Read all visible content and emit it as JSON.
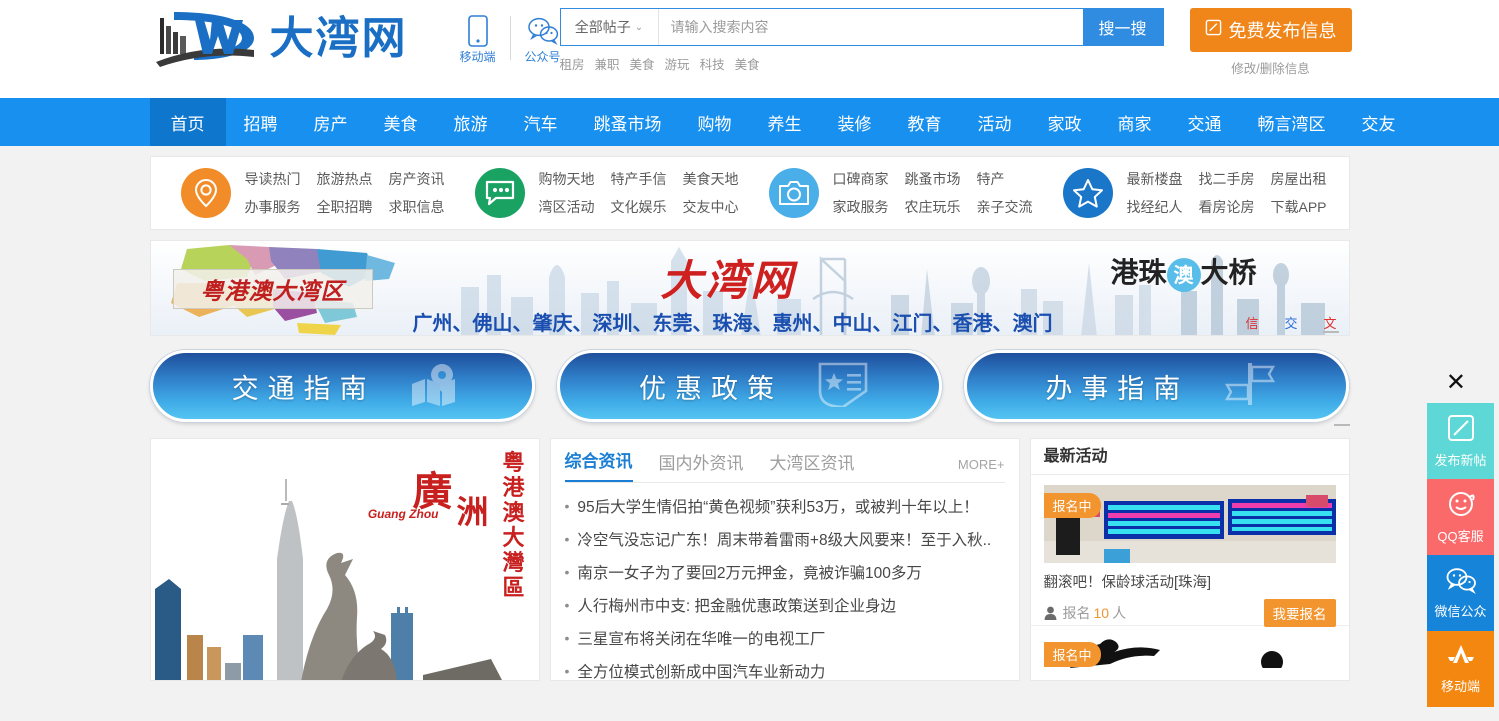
{
  "site": {
    "logo_text": "大湾网",
    "logo_mark": "dw-logo-icon"
  },
  "header": {
    "app_icons": [
      {
        "icon": "mobile-phone-icon",
        "label": "移动端"
      },
      {
        "icon": "wechat-icon",
        "label": "公众号"
      }
    ],
    "search": {
      "category": "全部帖子",
      "chevron": "⌄",
      "placeholder": "请输入搜索内容",
      "value": "",
      "button_label": "搜一搜",
      "hotwords": [
        "租房",
        "兼职",
        "美食",
        "游玩",
        "科技",
        "美食"
      ]
    },
    "publish": {
      "icon": "compose-icon",
      "label": "免费发布信息",
      "sub_label": "修改/删除信息",
      "color": "#f08519"
    }
  },
  "nav": {
    "active_index": 0,
    "bg_color": "#1890ef",
    "active_color": "#0f76cd",
    "items": [
      {
        "label": "首页"
      },
      {
        "label": "招聘"
      },
      {
        "label": "房产"
      },
      {
        "label": "美食"
      },
      {
        "label": "旅游"
      },
      {
        "label": "汽车"
      },
      {
        "label": "跳蚤市场"
      },
      {
        "label": "购物"
      },
      {
        "label": "养生"
      },
      {
        "label": "装修"
      },
      {
        "label": "教育"
      },
      {
        "label": "活动"
      },
      {
        "label": "家政"
      },
      {
        "label": "商家"
      },
      {
        "label": "交通"
      },
      {
        "label": "畅言湾区"
      },
      {
        "label": "交友"
      }
    ]
  },
  "quick_links": {
    "groups": [
      {
        "icon": "location-pin-icon",
        "color": "#f28c28",
        "links": [
          "导读热门",
          "旅游热点",
          "房产资讯",
          "办事服务",
          "全职招聘",
          "求职信息"
        ]
      },
      {
        "icon": "chat-bubble-icon",
        "color": "#1aa263",
        "links": [
          "购物天地",
          "特产手信",
          "美食天地",
          "湾区活动",
          "文化娱乐",
          "交友中心"
        ]
      },
      {
        "icon": "camera-icon",
        "color": "#4aaee8",
        "links": [
          "口碑商家",
          "跳蚤市场",
          "特产",
          "家政服务",
          "农庄玩乐",
          "亲子交流"
        ]
      },
      {
        "icon": "star-icon",
        "color": "#1a76c9",
        "links": [
          "最新楼盘",
          "找二手房",
          "房屋出租",
          "找经纪人",
          "看房论房",
          "下载APP"
        ]
      }
    ]
  },
  "banner": {
    "plaque_text": "粤港澳大湾区",
    "title": "大湾网",
    "cities": "广州、佛山、肇庆、深圳、东莞、珠海、惠州、中山、江门、香港、澳门",
    "bridge_a": "港珠",
    "bridge_ao": "澳",
    "bridge_b": "大桥",
    "tags": [
      {
        "label": "信息",
        "color": "#e03030"
      },
      {
        "label": "交流",
        "color": "#2a6fd8"
      },
      {
        "label": "文化",
        "color": "#e03030"
      }
    ]
  },
  "triple_buttons": [
    {
      "label": "交通指南",
      "icon": "map-pin-icon"
    },
    {
      "label": "优惠政策",
      "icon": "badge-star-icon"
    },
    {
      "label": "办事指南",
      "icon": "signpost-icon"
    }
  ],
  "left_image": {
    "city_big": "廣",
    "city_zhou": "洲",
    "pinyin": "Guang Zhou",
    "vertical": "粤港澳大灣區",
    "alt": "guangzhou-skyline-goat-statue-image"
  },
  "news": {
    "tabs": [
      {
        "label": "综合资讯",
        "active": true
      },
      {
        "label": "国内外资讯",
        "active": false
      },
      {
        "label": "大湾区资讯",
        "active": false
      }
    ],
    "more_label": "MORE+",
    "items": [
      "95后大学生情侣拍“黄色视频”获利53万，或被判十年以上！",
      "冷空气没忘记广东！周末带着雷雨+8级大风要来！至于入秋..",
      "南京一女子为了要回2万元押金，竟被诈骗100多万",
      "人行梅州市中支: 把金融优惠政策送到企业身边",
      "三星宣布将关闭在华唯一的电视工厂",
      "全方位模式创新成中国汽车业新动力"
    ]
  },
  "activities": {
    "title": "最新活动",
    "items": [
      {
        "badge": "报名中",
        "title": "翻滚吧！保龄球活动[珠海]",
        "signup_label": "报名",
        "count": "10",
        "count_unit": "人",
        "button_label": "我要报名",
        "thumb": "bowling-alley-scoreboard-image"
      },
      {
        "badge": "报名中",
        "title": "",
        "signup_label": "",
        "count": "",
        "count_unit": "",
        "button_label": "",
        "thumb": "sports-silhouette-image"
      }
    ]
  },
  "side_panel": {
    "close_icon": "close-icon",
    "buttons": [
      {
        "label": "发布新帖",
        "icon": "compose-icon",
        "color": "#5ed8d6"
      },
      {
        "label": "QQ客服",
        "icon": "smiley-face-icon",
        "color": "#fb6a6a"
      },
      {
        "label": "微信公众",
        "icon": "wechat-icon",
        "color": "#1684d8"
      },
      {
        "label": "移动端",
        "icon": "app-store-icon",
        "color": "#f4870f"
      }
    ]
  }
}
